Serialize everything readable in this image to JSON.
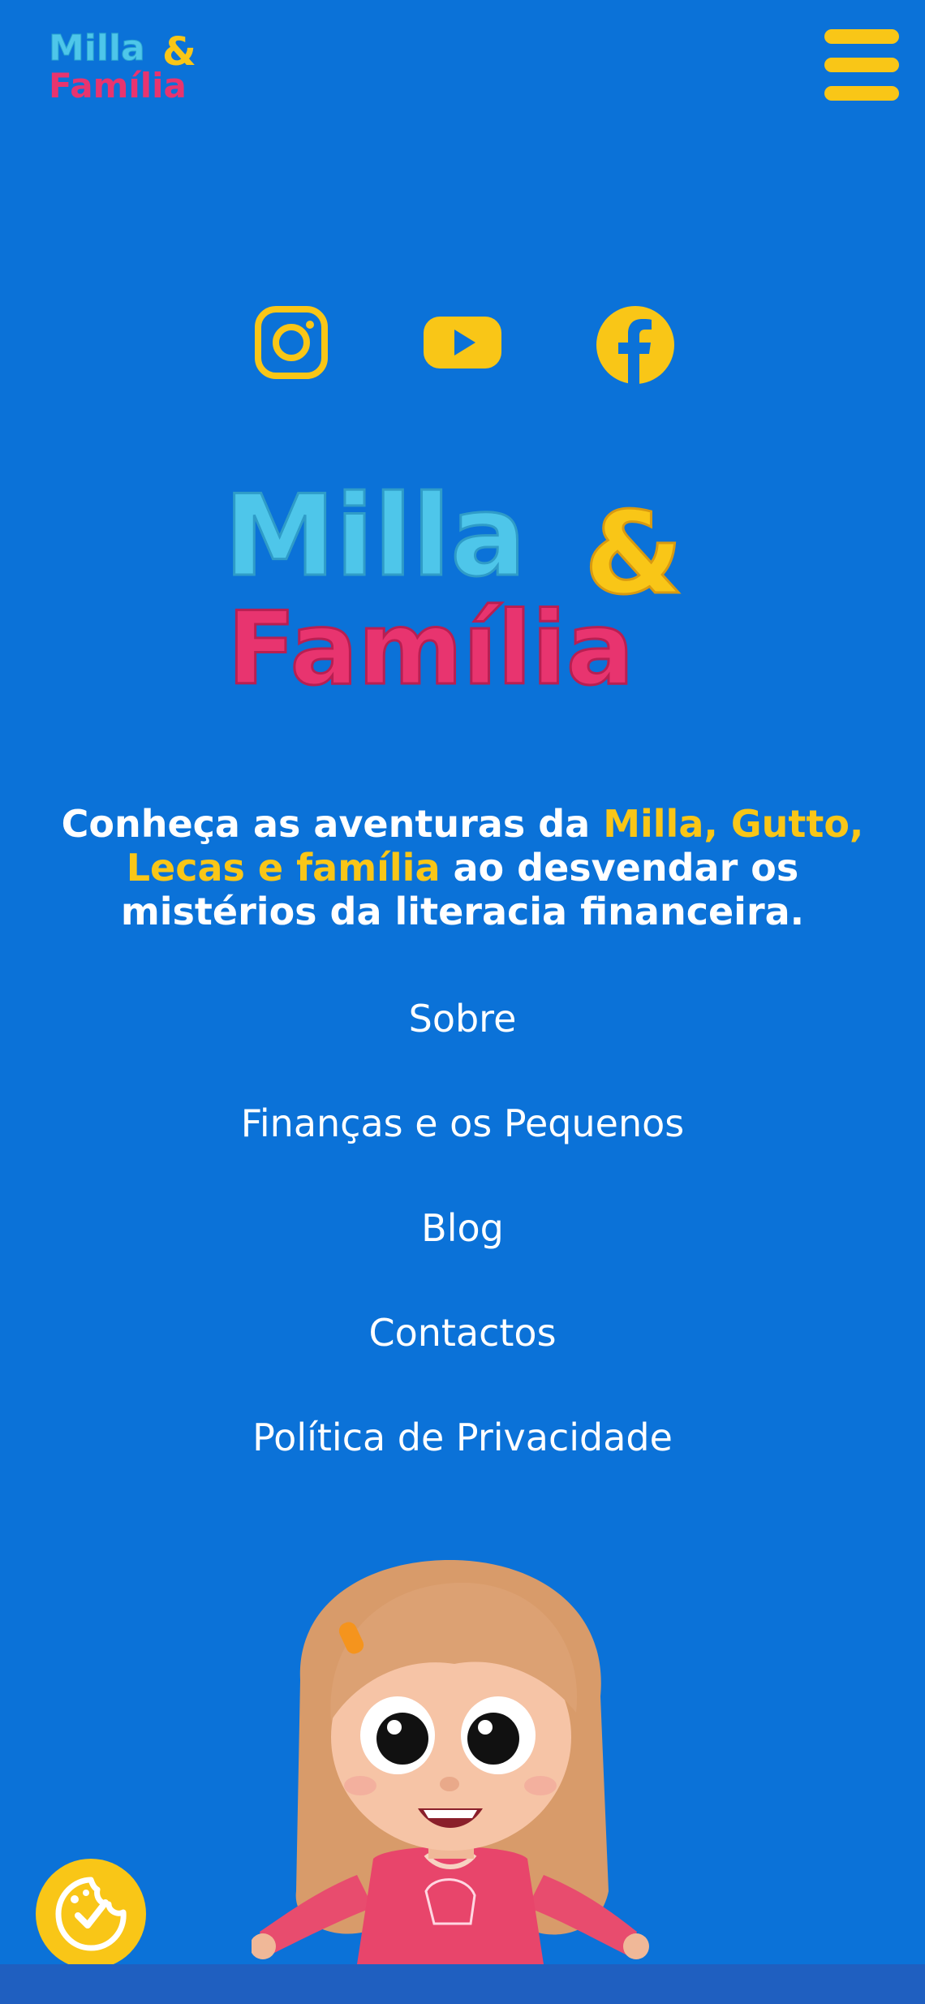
{
  "header": {
    "logo_line1": "Milla",
    "logo_amp": "&",
    "logo_line2": "Família",
    "menu_icon": "hamburger-menu-icon"
  },
  "social": [
    {
      "name": "Instagram",
      "icon": "instagram-icon"
    },
    {
      "name": "YouTube",
      "icon": "youtube-icon"
    },
    {
      "name": "Facebook",
      "icon": "facebook-icon"
    }
  ],
  "hero_logo": {
    "line1": "Milla",
    "amp": "&",
    "line2": "Família"
  },
  "tagline": {
    "part1": "Conheça as aventuras da ",
    "highlight1": "Milla, Gutto, Lecas e",
    "highlight2": "família",
    "part2": " ao desvendar os mistérios da literacia financeira."
  },
  "nav": {
    "items": [
      {
        "label": "Sobre"
      },
      {
        "label": "Finanças e os Pequenos"
      },
      {
        "label": "Blog"
      },
      {
        "label": "Contactos"
      },
      {
        "label": "Política de Privacidade"
      }
    ]
  },
  "cookie_button": {
    "icon": "cookie-consent-icon"
  },
  "colors": {
    "background": "#0b72d8",
    "accent_yellow": "#f9c617",
    "logo_cyan": "#4ec6ea",
    "logo_pink": "#e8346f",
    "text": "#ffffff"
  }
}
